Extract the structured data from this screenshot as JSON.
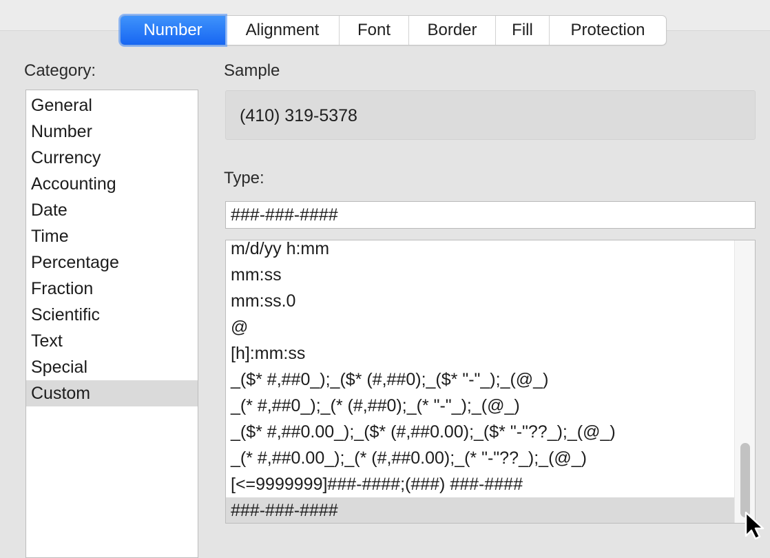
{
  "tabs": [
    {
      "label": "Number",
      "active": true
    },
    {
      "label": "Alignment",
      "active": false
    },
    {
      "label": "Font",
      "active": false
    },
    {
      "label": "Border",
      "active": false
    },
    {
      "label": "Fill",
      "active": false
    },
    {
      "label": "Protection",
      "active": false
    }
  ],
  "category": {
    "label": "Category:",
    "items": [
      "General",
      "Number",
      "Currency",
      "Accounting",
      "Date",
      "Time",
      "Percentage",
      "Fraction",
      "Scientific",
      "Text",
      "Special",
      "Custom"
    ],
    "selected": "Custom"
  },
  "sample": {
    "label": "Sample",
    "value": "(410) 319-5378"
  },
  "type": {
    "label": "Type:",
    "value": "###-###-####"
  },
  "format_list": {
    "items": [
      "m/d/yy h:mm",
      "mm:ss",
      "mm:ss.0",
      "@",
      "[h]:mm:ss",
      "_($* #,##0_);_($* (#,##0);_($* \"-\"_);_(@_)",
      "_(* #,##0_);_(* (#,##0);_(* \"-\"_);_(@_)",
      "_($* #,##0.00_);_($* (#,##0.00);_($* \"-\"??_);_(@_)",
      "_(* #,##0.00_);_(* (#,##0.00);_(* \"-\"??_);_(@_)",
      "[<=9999999]###-####;(###) ###-####",
      "###-###-####"
    ],
    "selected": "###-###-####"
  },
  "colors": {
    "accent": "#1a6cf3",
    "selection": "#dadada",
    "background": "#e4e4e4"
  },
  "icons": {
    "cursor": "arrow-cursor-icon"
  }
}
